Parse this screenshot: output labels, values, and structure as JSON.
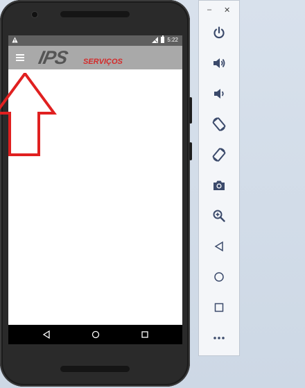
{
  "status_bar": {
    "time": "5:22",
    "warning_glyph": "warning-icon"
  },
  "app_bar": {
    "logo_main": "IPS",
    "logo_sub": "SERVIÇOS",
    "logo_sub_color": "#d42a2a",
    "bar_color": "#a9a9a9"
  },
  "nav_bar": {
    "buttons": [
      "back",
      "home",
      "recents"
    ]
  },
  "emulator_toolbar": {
    "window_buttons": {
      "minimize": "–",
      "close": "✕"
    },
    "tools": [
      "power",
      "volume-up",
      "volume-down",
      "rotate-left",
      "rotate-right",
      "screenshot",
      "zoom",
      "back",
      "home",
      "overview",
      "more"
    ]
  },
  "annotation": {
    "arrow_color": "#e02020"
  }
}
